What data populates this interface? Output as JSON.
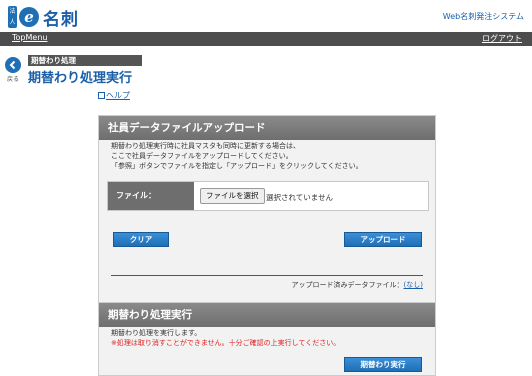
{
  "header": {
    "logo_badge": "法人",
    "logo_text": "名刺",
    "system_name": "Web名刺発注システム"
  },
  "menu": {
    "top": "TopMenu",
    "logout": "ログアウト"
  },
  "back": {
    "label": "戻る"
  },
  "breadcrumb": "期替わり処理",
  "page_title": "期替わり処理実行",
  "help": "ヘルプ",
  "upload_section": {
    "title": "社員データファイルアップロード",
    "desc_lines": [
      "期替わり処理実行時に社員マスタも同時に更新する場合は、",
      "ここで社員データファイルをアップロードしてください。",
      "「参照」ボタンでファイルを指定し「アップロード」をクリックしてください。"
    ],
    "file_label": "ファイル：",
    "choose_button": "ファイルを選択",
    "file_status": "選択されていません",
    "clear_button": "クリア",
    "upload_button": "アップロード",
    "uploaded_label": "アップロード済みデータファイル：",
    "uploaded_value": "(なし)"
  },
  "exec_section": {
    "title": "期替わり処理実行",
    "desc": "期替わり処理を実行します。",
    "warning": "※処理は取り消すことができません。十分ご確認の上実行してください。",
    "exec_button": "期替わり実行"
  },
  "colors": {
    "brand_blue": "#1f6fb5",
    "menubar": "#4d4d4d",
    "panel_header": "#7a7a7a",
    "warning_red": "#e02020"
  }
}
